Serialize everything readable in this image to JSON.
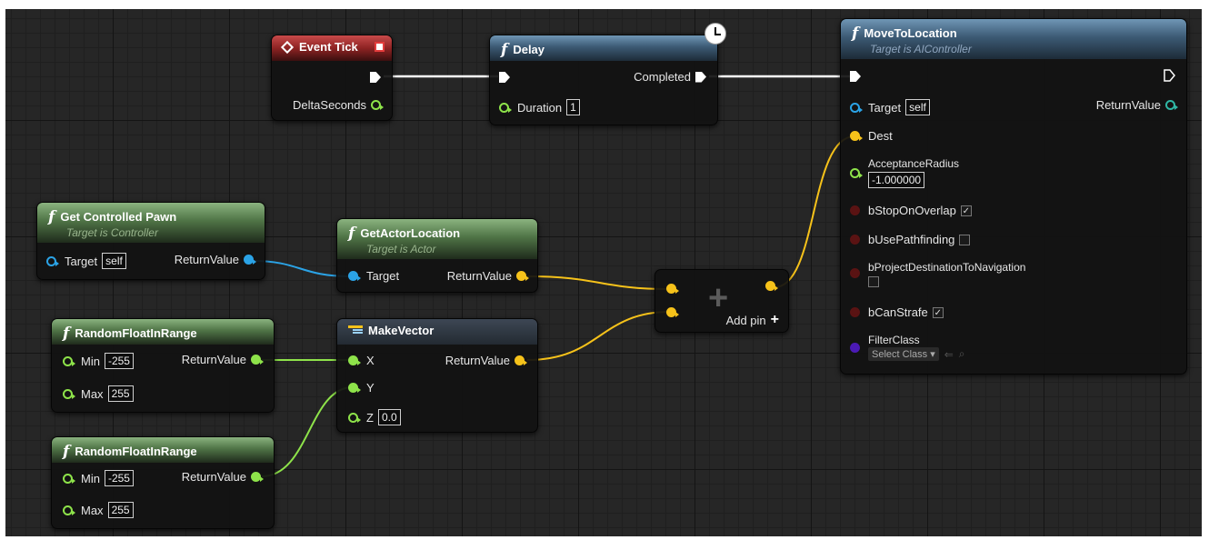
{
  "colors": {
    "exec": "#ffffff",
    "vector": "#f6c21a",
    "float": "#8ee34a",
    "object": "#2ba3e6",
    "bool": "#5a1313",
    "class": "#4b1ab5",
    "grid_background": "#262626"
  },
  "nodes": {
    "event_tick": {
      "title": "Event Tick",
      "delta_seconds": "DeltaSeconds"
    },
    "delay": {
      "title": "Delay",
      "completed": "Completed",
      "duration_label": "Duration",
      "duration_value": "1"
    },
    "move_to_location": {
      "title": "MoveToLocation",
      "subtitle": "Target is AIController",
      "target_label": "Target",
      "target_value": "self",
      "return_value": "ReturnValue",
      "dest": "Dest",
      "acceptance_radius_label": "AcceptanceRadius",
      "acceptance_radius_value": "-1.000000",
      "b_stop_on_overlap": "bStopOnOverlap",
      "b_stop_on_overlap_checked": true,
      "b_use_pathfinding": "bUsePathfinding",
      "b_use_pathfinding_checked": false,
      "b_project_destination": "bProjectDestinationToNavigation",
      "b_project_destination_checked": false,
      "b_can_strafe": "bCanStrafe",
      "b_can_strafe_checked": true,
      "filter_class": "FilterClass",
      "select_class": "Select Class"
    },
    "get_controlled_pawn": {
      "title": "Get Controlled Pawn",
      "subtitle": "Target is Controller",
      "target_label": "Target",
      "target_value": "self",
      "return_value": "ReturnValue"
    },
    "get_actor_location": {
      "title": "GetActorLocation",
      "subtitle": "Target is Actor",
      "target_label": "Target",
      "return_value": "ReturnValue"
    },
    "add_node": {
      "add_pin": "Add pin"
    },
    "random_float_1": {
      "title": "RandomFloatInRange",
      "min_label": "Min",
      "min_value": "-255",
      "max_label": "Max",
      "max_value": "255",
      "return_value": "ReturnValue"
    },
    "make_vector": {
      "title": "MakeVector",
      "x": "X",
      "y": "Y",
      "z": "Z",
      "z_value": "0.0",
      "return_value": "ReturnValue"
    },
    "random_float_2": {
      "title": "RandomFloatInRange",
      "min_label": "Min",
      "min_value": "-255",
      "max_label": "Max",
      "max_value": "255",
      "return_value": "ReturnValue"
    }
  }
}
